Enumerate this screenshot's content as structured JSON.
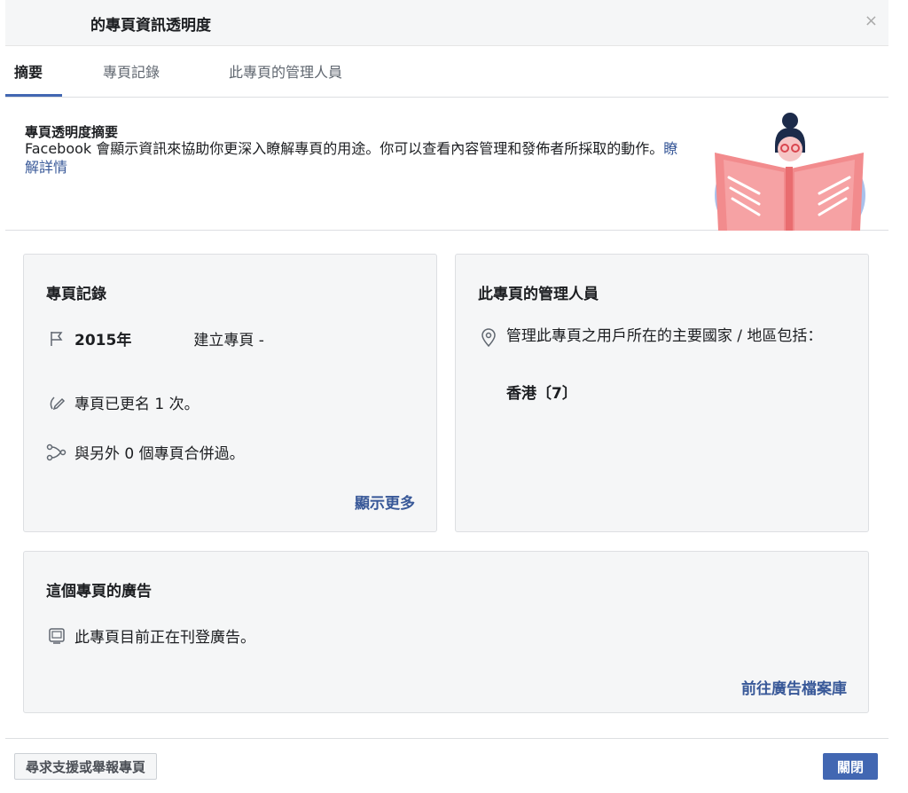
{
  "dialog": {
    "title": "的專頁資訊透明度",
    "close_symbol": "×"
  },
  "tabs": [
    {
      "label": "摘要",
      "active": true
    },
    {
      "label": "專頁記錄",
      "active": false
    },
    {
      "label": "此專頁的管理人員",
      "active": false
    }
  ],
  "summary": {
    "title": "專頁透明度摘要",
    "text": "Facebook 會顯示資訊來協助你更深入瞭解專頁的用途。你可以查看內容管理和發佈者所採取的動作。",
    "link": "瞭解詳情"
  },
  "history_card": {
    "title": "專頁記錄",
    "created_year": "2015年",
    "created_text": "建立專頁 -",
    "rename_text": "專頁已更名 1 次。",
    "merge_text": "與另外 0 個專頁合併過。",
    "show_more": "顯示更多"
  },
  "managers_card": {
    "title": "此專頁的管理人員",
    "country_text": "管理此專頁之用戶所在的主要國家 / 地區包括：",
    "country_value": "香港〔7〕"
  },
  "ads_card": {
    "title": "這個專頁的廣告",
    "status_text": "此專頁目前正在刊登廣告。",
    "library_link": "前往廣告檔案庫"
  },
  "footer": {
    "report_button": "尋求支援或舉報專頁",
    "close_button": "關閉"
  },
  "icons": {
    "history_created": "flag-icon",
    "history_rename": "pencil-icon",
    "history_merge": "merge-icon",
    "managers_location": "location-pin-icon",
    "ads_status": "ad-screen-icon"
  },
  "colors": {
    "accent_blue": "#4267b2",
    "link_blue": "#385898",
    "card_bg": "#f5f6f7"
  }
}
